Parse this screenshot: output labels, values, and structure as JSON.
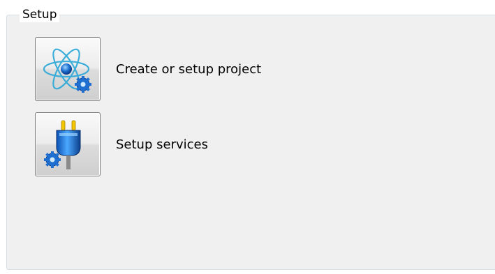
{
  "group": {
    "title": "Setup"
  },
  "actions": [
    {
      "label": "Create or setup project",
      "icon": "atom-gear-icon"
    },
    {
      "label": "Setup services",
      "icon": "plug-gear-icon"
    }
  ],
  "colors": {
    "panel_background": "#f0f0f0",
    "group_border": "#d5dfe5",
    "icon_blue": "#1e6fd0",
    "plug_yellow": "#f2c500"
  }
}
